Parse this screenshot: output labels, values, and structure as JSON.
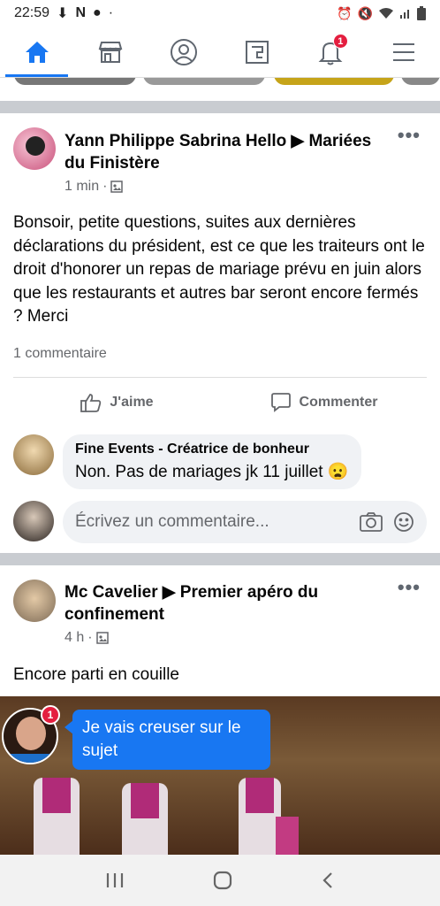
{
  "status_bar": {
    "time": "22:59"
  },
  "nav": {
    "tabs": [
      {
        "name": "home",
        "icon": "home-icon"
      },
      {
        "name": "marketplace",
        "icon": "store-icon"
      },
      {
        "name": "profile",
        "icon": "profile-icon"
      },
      {
        "name": "pages",
        "icon": "pages-icon"
      },
      {
        "name": "notifications",
        "icon": "bell-icon",
        "badge": "1"
      },
      {
        "name": "menu",
        "icon": "menu-icon"
      }
    ],
    "active_color": "#1877f2"
  },
  "post1": {
    "author": "Yann Philippe Sabrina Hello ▶ Mariées du Finistère",
    "time": "1 min",
    "text": "Bonsoir,  petite questions, suites aux dernières déclarations du président,  est ce que les traiteurs ont le droit d'honorer un repas de mariage prévu en juin alors que les restaurants et autres bar seront encore fermés ? Merci",
    "comment_count": "1 commentaire",
    "like_label": "J'aime",
    "comment_label": "Commenter",
    "comment": {
      "name": "Fine Events - Créatrice de bonheur",
      "text": "Non. Pas de mariages jk 11 juillet 😦"
    },
    "composer_placeholder": "Écrivez un commentaire..."
  },
  "post2": {
    "author_name": "Mc Cavelier",
    "author_group": "Premier apéro du confinement",
    "time": "4 h",
    "text": "Encore parti en couille"
  },
  "chat_head": {
    "badge": "1",
    "message": "Je vais creuser sur le sujet"
  }
}
